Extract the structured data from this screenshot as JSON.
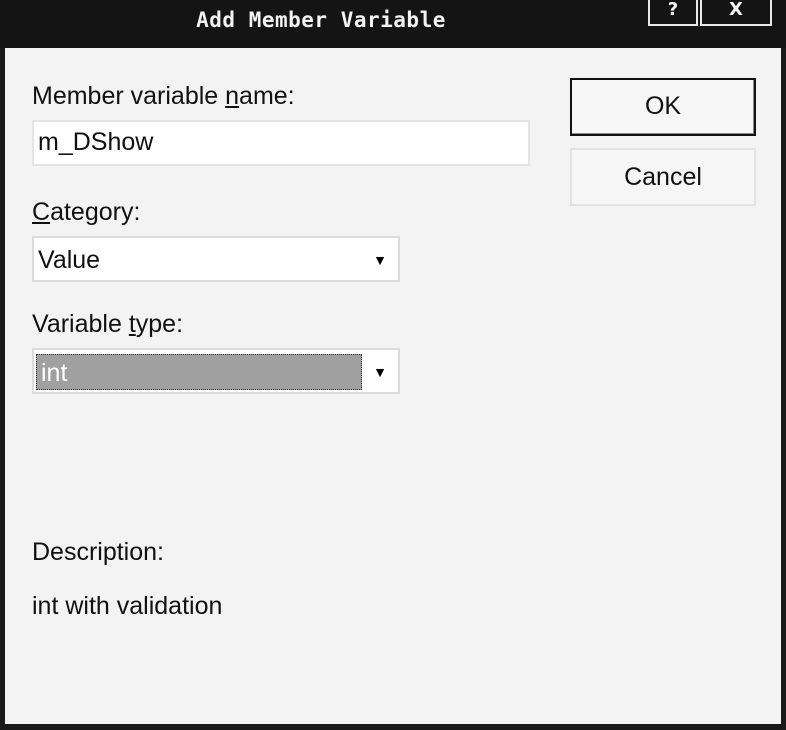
{
  "window": {
    "title": "Add Member Variable",
    "help_label": "?",
    "close_label": "X"
  },
  "form": {
    "name_label_pre": "Member variable ",
    "name_label_hot": "n",
    "name_label_post": "ame:",
    "name_value": "m_DShow",
    "category_label_hot": "C",
    "category_label_post": "ategory:",
    "category_value": "Value",
    "type_label_pre": "Variable ",
    "type_label_hot": "t",
    "type_label_post": "ype:",
    "type_value": "int",
    "description_label": "Description:",
    "description_text": "int with validation"
  },
  "buttons": {
    "ok": "OK",
    "cancel": "Cancel"
  },
  "icons": {
    "dropdown": "dropdown-arrow-icon"
  }
}
